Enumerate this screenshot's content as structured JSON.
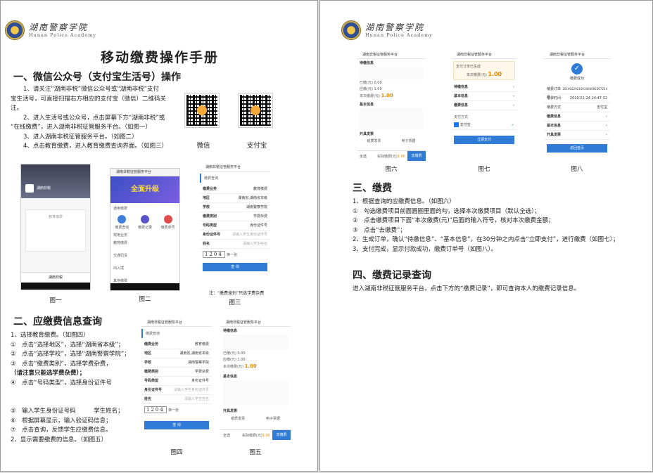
{
  "logo": {
    "cn": "湖南警察学院",
    "en": "Hunan Police Academy"
  },
  "page1": {
    "title": "移动缴费操作手册",
    "sec1": {
      "heading": "一、微信公众号（支付宝生活号）操作",
      "lines": [
        "1、请关注“湖南非税”微信公众号或“湖南非税”支付",
        "宝生活号，可直接扫描右方相应的支付宝（微信）二维码关",
        "注。",
        "2、进入生活号或公众号，点击屏幕下方“湖南非税”或",
        "“在线缴费”，进入湖南非税征管服务平台。（如图一）",
        "3、进入湖南非税征管服务平台。（如图二）",
        "4、点击教育缴费，进入教育缴费查询界面。（如图三）"
      ],
      "qr_labels": [
        "微信",
        "支付宝"
      ]
    },
    "fig1": {
      "caption": "图一",
      "banner": "湖南非税",
      "card": "教育缴费",
      "tab": "湖南非税"
    },
    "fig2": {
      "caption": "图二",
      "header": "湖南非税征管服务平台",
      "promo": "全面升级",
      "sec_a": "通用缴费",
      "sec_b": "常用业务",
      "icons": [
        "缴费查询",
        "缴费记录",
        "缴费单号"
      ],
      "items": [
        "教育缴费",
        "交通罚没",
        "出入境",
        "其他缴费"
      ]
    },
    "fig3": {
      "caption": "图三",
      "header": "湖南非税征管服务平台",
      "form_title": "缴费查询",
      "rows": [
        [
          "缴费业务",
          "教育缴费"
        ],
        [
          "地区",
          "湖南省,湖南省本级"
        ],
        [
          "学校",
          "湖南警察学院"
        ],
        [
          "缴费类别",
          "学费杂费"
        ],
        [
          "号码类型",
          "身份证件号"
        ],
        [
          "身份证件号",
          "请输入学生身份证件号"
        ],
        [
          "姓名",
          "请输入学生姓名"
        ]
      ],
      "captcha": "1204",
      "captcha_hint": "换一张",
      "query_btn": "查 询",
      "note": "注：“缴费类别”只选学费杂费"
    },
    "sec2": {
      "heading": "二、应缴费信息查询",
      "lines": [
        "1、选择教育缴费。（如图四）",
        "①　点击“选择地区”，选择“湖南省本级”；",
        "②　点击“选择学校”，选择“湖南警察学院”；",
        "③　点击“缴费类别”，选择学费杂费，",
        "（请注意只能选学费杂费）；",
        "④　点击“号码类型”，选择身份证件号",
        "",
        "",
        "⑤　输入学生身份证号码　　　学生姓名；",
        "⑥　根据屏幕显示，输入验证码信息；",
        "⑦　点击查询，反馈学生应缴费信息。",
        "2、显示需要缴费的信息。（如图五）"
      ]
    },
    "fig4": {
      "caption": "图四"
    },
    "fig5": {
      "caption": "图五",
      "header": "湖南非税征管服务平台",
      "pending": "待缴信息",
      "basic": "基本信息",
      "invoice": "开具发票",
      "amount_label": "本次缴费(元)",
      "amount": "1.00",
      "paid_label": "已缴(元)",
      "paid": "0.00",
      "due_label": "应缴(元)",
      "due": "1.00",
      "invoice_opts": [
        "纸质发票",
        "电子票据"
      ],
      "select_all": "全选",
      "pay_btn": "去缴费",
      "total_label": "实际缴费(元)",
      "total": "1.00"
    }
  },
  "page2": {
    "fig6": {
      "caption": "图六"
    },
    "fig7": {
      "caption": "图七",
      "header": "湖南非税征管服务平台",
      "order": "支付订单已生成",
      "amount_label": "本次缴费(元)",
      "amount": "1.00",
      "sections": [
        "待缴信息",
        "基本信息",
        "缴费信息"
      ],
      "pay_method": "支付方式",
      "alipay": "支付宝",
      "pay_btn": "立即支付"
    },
    "fig8": {
      "caption": "图八",
      "header": "湖南非税征管服务平台",
      "success": "缴费成功",
      "rows": [
        [
          "缴费订单号",
          "2019022921001004092367214"
        ],
        [
          "缴费时间",
          "2019-02-24 14:47:32"
        ],
        [
          "缴费方式",
          "支付宝"
        ],
        [
          "缴费信息",
          ""
        ],
        [
          "基本信息",
          ""
        ],
        [
          "开具发票",
          ""
        ]
      ],
      "back_btn": "返回首页"
    },
    "sec3": {
      "heading": "三、缴费",
      "lines": [
        "1、根据查询的应缴费信息。（如图六）",
        "①　勾选缴费项目前面圆圈里面的勾，选择本次缴费项目（默认全选）；",
        "②　点击缴费项目下面“本次缴费(元)”后面的输入符号，核对本次缴费金额；",
        "③　点击“去缴费”；",
        "2、生成订单，确认“待缴信息”、“基本信息”，在30分钟之内点击“立即支付”，进行缴费（如图七）；",
        "3、支付完成，显示付款成功，缴费订单号（如图八）。"
      ]
    },
    "sec4": {
      "heading": "四、缴费记录查询",
      "line": "进入湖南非税征管服务平台，点击下方的“缴费记录”，即可查询本人的缴费记录信息。"
    }
  }
}
